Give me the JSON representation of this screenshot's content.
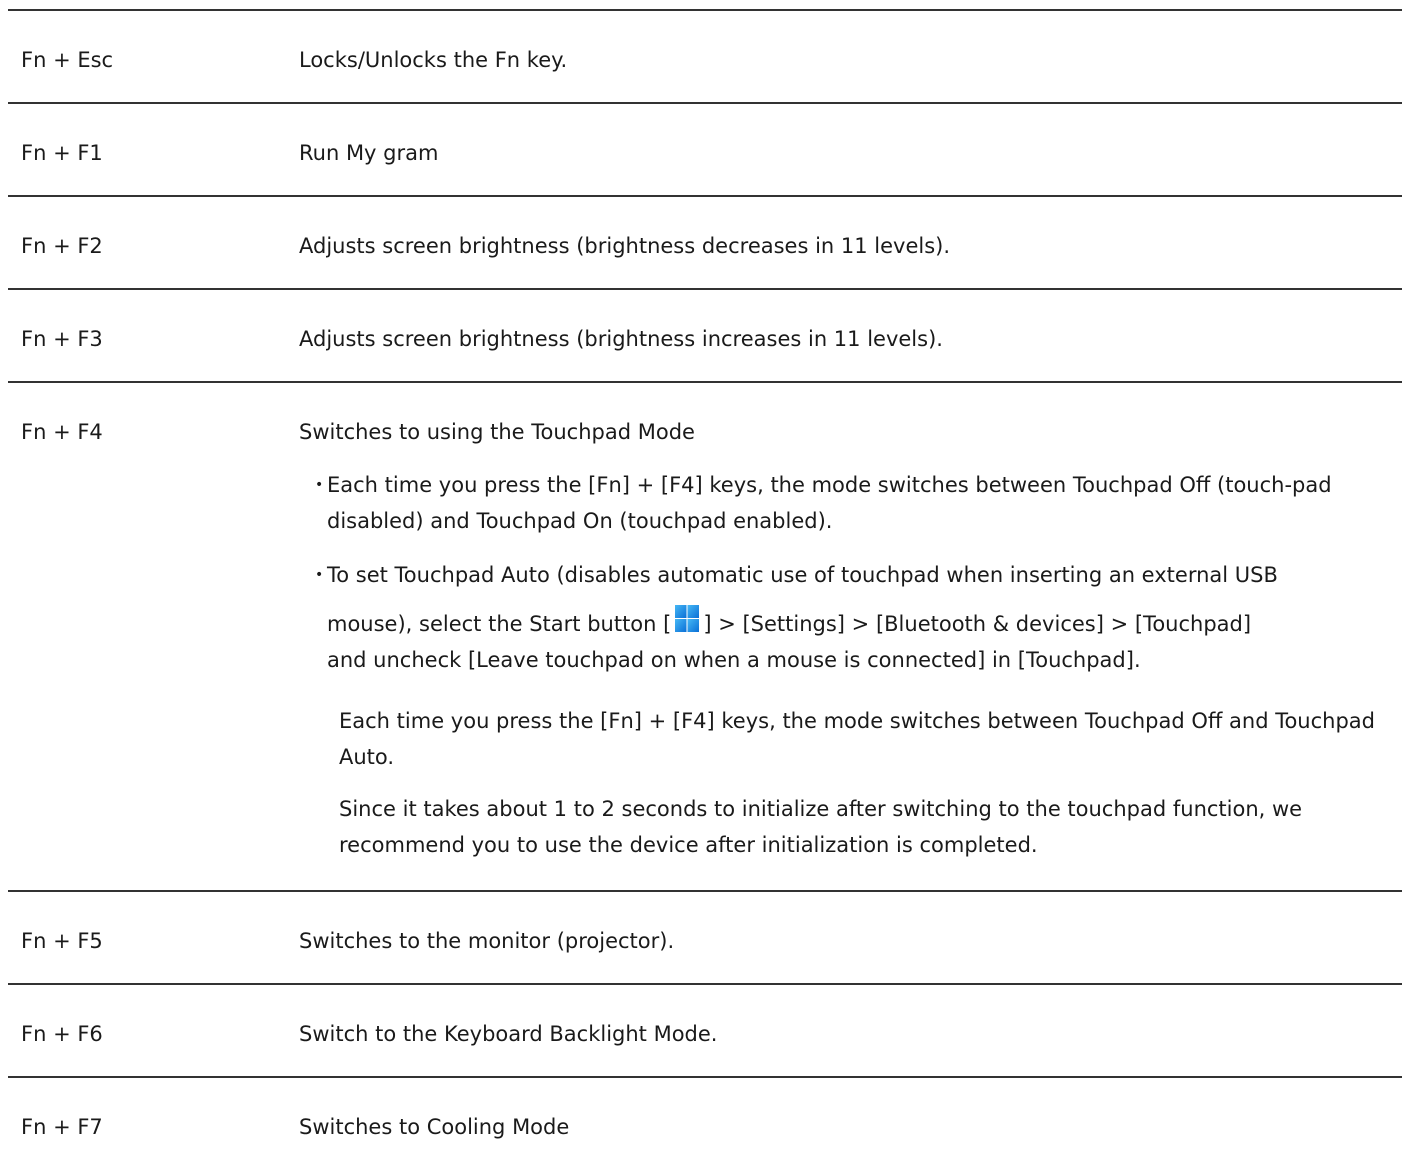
{
  "rows": [
    {
      "key": "Fn + Esc",
      "desc": "Locks/Unlocks the Fn key."
    },
    {
      "key": "Fn + F1",
      "desc": "Run My gram"
    },
    {
      "key": "Fn + F2",
      "desc": "Adjusts screen brightness (brightness decreases in 11 levels)."
    },
    {
      "key": "Fn + F3",
      "desc": "Adjusts screen brightness (brightness increases in 11 levels)."
    },
    {
      "key": "Fn + F4",
      "desc": "Switches to using the Touchpad Mode"
    },
    {
      "key": "Fn + F5",
      "desc": "Switches to the monitor (projector)."
    },
    {
      "key": "Fn + F6",
      "desc": "Switch to the Keyboard Backlight Mode."
    },
    {
      "key": "Fn + F7",
      "desc": "Switches to Cooling Mode"
    }
  ],
  "f4_details": {
    "bullet1": "Each time you press the [Fn] + [F4] keys, the mode switches between Touchpad Off (touch-pad disabled) and Touchpad On (touchpad enabled).",
    "bullet2_line1": "To set Touchpad Auto (disables automatic use of touchpad when inserting an external USB",
    "bullet2_pre_icon": "mouse), select the Start button [",
    "bullet2_post_icon": "] > [Settings] > [Bluetooth & devices] > [Touchpad]",
    "bullet2_line3": "and uncheck [Leave touchpad on when a mouse is connected] in [Touchpad].",
    "para1": "Each time you press the [Fn] + [F4] keys, the mode switches between Touchpad Off and Touchpad Auto.",
    "para2": "Since it takes about 1 to 2 seconds to initialize after switching to the touchpad function, we recommend you to use the device after initialization is completed.",
    "start_icon": "windows-start-icon"
  },
  "colors": {
    "rule": "#333333",
    "text": "#1a1a1a",
    "start_icon_blue": "#1e90e0"
  }
}
